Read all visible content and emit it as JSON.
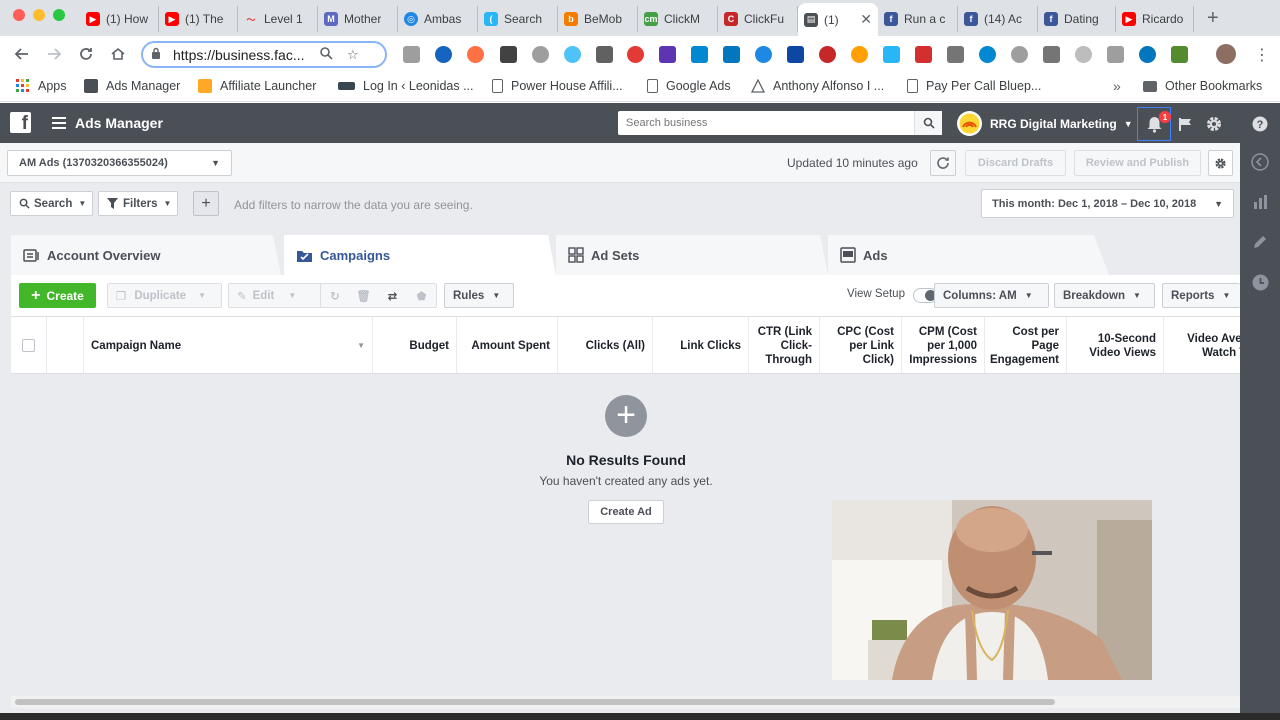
{
  "browser": {
    "tabs": [
      {
        "title": "(1) How",
        "favicon": "youtube-icon",
        "color": "#ff0000"
      },
      {
        "title": "(1) The",
        "favicon": "youtube-icon",
        "color": "#ff0000"
      },
      {
        "title": "Level 1",
        "favicon": "chart-icon",
        "color": "#e53935"
      },
      {
        "title": "Mother",
        "favicon": "page-icon",
        "color": "#5c6bc0"
      },
      {
        "title": "Ambas",
        "favicon": "globe-icon",
        "color": "#1e88e5"
      },
      {
        "title": "Search",
        "favicon": "bracket-icon",
        "color": "#29b6f6"
      },
      {
        "title": "BeMob",
        "favicon": "bemob-icon",
        "color": "#f57c00"
      },
      {
        "title": "ClickM",
        "favicon": "clickmagick-icon",
        "color": "#43a047"
      },
      {
        "title": "ClickFu",
        "favicon": "clickfunnels-icon",
        "color": "#c62828"
      },
      {
        "title": "(1)",
        "favicon": "ads-manager-icon",
        "color": "#4b4f56",
        "active": true
      },
      {
        "title": "Run a c",
        "favicon": "facebook-icon",
        "color": "#3b5998"
      },
      {
        "title": "(14) Ac",
        "favicon": "facebook-icon",
        "color": "#3b5998"
      },
      {
        "title": "Dating",
        "favicon": "facebook-icon",
        "color": "#3b5998"
      },
      {
        "title": "Ricardo",
        "favicon": "youtube-icon",
        "color": "#ff0000"
      }
    ],
    "close_glyph": "✕",
    "new_tab_glyph": "+",
    "url": "https://business.fac...",
    "bookmarks": [
      {
        "label": "Apps",
        "icon": "apps-grid-icon"
      },
      {
        "label": "Ads Manager",
        "icon": "ads-manager-icon"
      },
      {
        "label": "Affiliate Launcher",
        "icon": "pa-icon"
      },
      {
        "label": "Log In ‹ Leonidas ...",
        "icon": "lmb-icon"
      },
      {
        "label": "Power House Affili...",
        "icon": "page-icon"
      },
      {
        "label": "Google Ads",
        "icon": "page-icon"
      },
      {
        "label": "Anthony Alfonso I ...",
        "icon": "triangle-icon"
      },
      {
        "label": "Pay Per Call Bluep...",
        "icon": "page-icon"
      }
    ],
    "bookmarks_more": "»",
    "other_bookmarks": "Other Bookmarks"
  },
  "fb": {
    "app_title": "Ads Manager",
    "search_placeholder": "Search business",
    "business_name": "RRG Digital Marketing",
    "notification_count": "1"
  },
  "account": {
    "selector": "AM Ads (1370320366355024)",
    "updated": "Updated 10 minutes ago",
    "discard": "Discard Drafts",
    "review": "Review and Publish"
  },
  "filters": {
    "search": "Search",
    "filters": "Filters",
    "hint": "Add filters to narrow the data you are seeing.",
    "date_range": "This month: Dec 1, 2018 – Dec 10, 2018"
  },
  "tabs": {
    "account_overview": "Account Overview",
    "campaigns": "Campaigns",
    "ad_sets": "Ad Sets",
    "ads": "Ads"
  },
  "actions": {
    "create": "Create",
    "duplicate": "Duplicate",
    "edit": "Edit",
    "rules": "Rules",
    "view_setup": "View Setup",
    "columns": "Columns: AM",
    "breakdown": "Breakdown",
    "reports": "Reports"
  },
  "table": {
    "columns": [
      "Campaign Name",
      "Budget",
      "Amount Spent",
      "Clicks (All)",
      "Link Clicks",
      "CTR (Link Click-Through",
      "CPC (Cost per Link Click)",
      "CPM (Cost per 1,000 Impressions",
      "Cost per Page Engagement",
      "10-Second Video Views",
      "Video Average Watch Time"
    ]
  },
  "empty": {
    "title": "No Results Found",
    "subtitle": "You haven't created any ads yet.",
    "button": "Create Ad"
  },
  "colors": {
    "fb_bar": "#4b4f56",
    "create_green": "#42b72a",
    "link_blue": "#365899"
  }
}
